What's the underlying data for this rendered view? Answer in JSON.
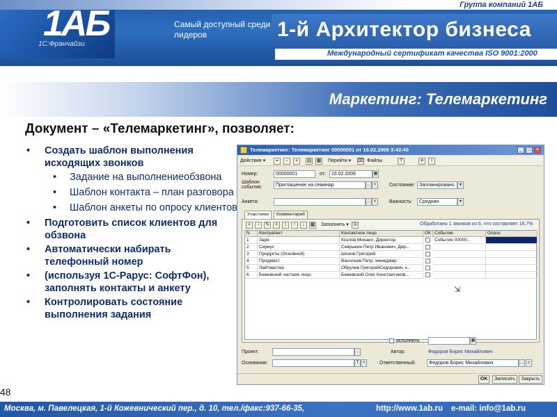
{
  "header": {
    "group_name": "Группа компаний 1АБ",
    "logo_text": "1АБ",
    "logo_sub": "1С:Франчайзи",
    "slogan": "Самый доступный среди лидеров",
    "title": "1-й Архитектор бизнеса",
    "certificate": "Международный сертификат качества ISO 9001:2000"
  },
  "section_title": "Маркетинг: Телемаркетинг",
  "doc_heading": "Документ – «Телемаркетинг», позволяет:",
  "bullets": {
    "item1": "Создать шаблон выполнения исходящих звонков",
    "sub1": "Задание на выполнениеобзвона",
    "sub2": "Шаблон контакта – план разговора",
    "sub3": "Шаблон анкеты по опросу клиентов",
    "item2": "Подготовить список клиентов для обзвона",
    "item3": "Автоматически набирать телефонный номер",
    "item4": "(используя 1С-Рарус: СофтФон), заполнять контакты и анкету",
    "item5": "Контролировать состояние выполнения задания"
  },
  "page_number": "48",
  "footer": {
    "address": "Москва, м. Павелецкая, 1-й Кожевнический пер., д. 10, тел./факс:937-66-35,",
    "web": "http://www.1ab.ru",
    "email": "e-mail: info@1ab.ru"
  },
  "window": {
    "title": "Телемаркетинг: Телемаркетинг 00000001 от 16.02.2006 3:43:40",
    "toolbar": {
      "actions": "Действия ▾",
      "goto": "Перейти ▾",
      "files": "Файлы"
    },
    "labels": {
      "number": "Номер:",
      "from": "от:",
      "template": "Шаблон события:",
      "survey": "Анкета:",
      "state": "Состояние:",
      "importance": "Важность:"
    },
    "values": {
      "number": "00000001",
      "date": "16.02.2006",
      "template": "Приглашение на семинар",
      "state": "Запланировано",
      "importance": "Средняя"
    },
    "tabs": [
      "Участники",
      "Комментарий"
    ],
    "fill_button": "Заполнить ▾",
    "progress_text": "Обработано 1 звонков из 6, что составляет 16,7%",
    "grid": {
      "headers": [
        "N",
        "Контрагент",
        "Контактное лицо",
        "ОК",
        "Событие",
        "Опрос"
      ],
      "rows": [
        {
          "n": "1",
          "contractor": "Заря",
          "contact": "Козлов Михаил, Директор",
          "event": "Событие 00000..."
        },
        {
          "n": "2",
          "contractor": "Сириус",
          "contact": "Севрыкин Петр Иванович, Дир...",
          "event": ""
        },
        {
          "n": "3",
          "contractor": "Продукты (Основной)",
          "contact": "Шонов Григорий",
          "event": ""
        },
        {
          "n": "4",
          "contractor": "Продмаст",
          "contact": "Васильев Петр, менеджер",
          "event": ""
        },
        {
          "n": "5",
          "contractor": "Лайтмастер",
          "contact": "Обручев ГригорийСидорович, к...",
          "event": ""
        },
        {
          "n": "6",
          "contractor": "Бежевский частное лицо",
          "contact": "Бежевский Олег Константинов...",
          "event": ""
        }
      ]
    },
    "execute_label": "исполнить",
    "project_label": "Проект:",
    "author_label": "Автор:",
    "author_value": "Федоров Борис Михайлович",
    "basis_label": "Основание:",
    "responsible_label": "Ответственный:",
    "responsible_value": "Федоров Борис Михайлович",
    "buttons": {
      "ok": "OK",
      "save": "Записать",
      "close": "Закрыть"
    }
  }
}
